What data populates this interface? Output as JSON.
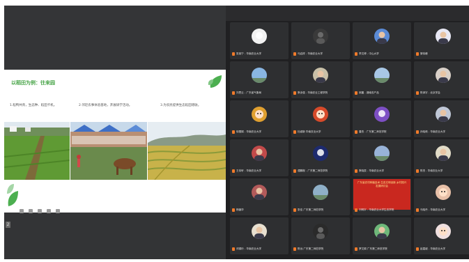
{
  "slide": {
    "title": "以稻田为例：往来园",
    "captions": [
      "1.稻鸭共育，生态种、稻田卡机。",
      "2.邻近农事体验基地，开展研学活动。",
      "3.为农民提供生态稻田增收。"
    ],
    "photos": [
      {
        "name": "rice-field-ridge-photo"
      },
      {
        "name": "farm-crowd-cattle-photo"
      },
      {
        "name": "rice-terrace-photo"
      }
    ],
    "page_indicator": "2"
  },
  "participants": [
    {
      "name": "张某宁 - 华南农业大学",
      "mic": "#f07a2a",
      "avatar": "#f2f2f2",
      "tone": "icon"
    },
    {
      "name": "马启祥 - 华南农业大学",
      "mic": "#f07a2a",
      "avatar": "#3a3a3a",
      "tone": "dark",
      "host": true
    },
    {
      "name": "李文博 - 中山大学",
      "mic": "#f07a2a",
      "avatar": "#5b8bd6",
      "tone": "person"
    },
    {
      "name": "黎伟峰",
      "mic": "#f07a2a",
      "avatar": "#e8e8f4",
      "tone": "person"
    },
    {
      "name": "刘思云 - 广东省气象局",
      "mic": "#f07a2a",
      "avatar": "#89b6e2",
      "tone": "sky"
    },
    {
      "name": "蔡泳强 - 华南农业工程学院",
      "mic": "#f07a2a",
      "avatar": "#c9c0a8",
      "tone": "person"
    },
    {
      "name": "邱晨 - 湖南农产品",
      "mic": "#f07a2a",
      "avatar": "#a8c7e6",
      "tone": "sky"
    },
    {
      "name": "陈泽宇 - 北京学会",
      "mic": "#f07a2a",
      "avatar": "#d9d0c8",
      "tone": "person"
    },
    {
      "name": "徐雪娟 - 华南农业大学",
      "mic": "#f07a2a",
      "avatar": "#e0a030",
      "tone": "cartoon"
    },
    {
      "name": "杜颖新 华南农业大学",
      "mic": "#f07a2a",
      "avatar": "#d64a2a",
      "tone": "cartoon"
    },
    {
      "name": "唐杰 - 广东第二师范学院",
      "mic": "#f07a2a",
      "avatar": "#7d4fc4",
      "tone": "icon"
    },
    {
      "name": "孙晓莉 - 华南农业大学",
      "mic": "#f07a2a",
      "avatar": "#bfc7d6",
      "tone": "person"
    },
    {
      "name": "王伟轩 - 华南农业大学",
      "mic": "#f07a2a",
      "avatar": "#c24a4a",
      "tone": "person"
    },
    {
      "name": "谭鹏程 - 广东第二师范学院",
      "mic": "#f07a2a",
      "avatar": "#1d2a6e",
      "tone": "icon"
    },
    {
      "name": "蔡晓辰 - 华南农业大学",
      "mic": "#f07a2a",
      "avatar": "#98b3d8",
      "tone": "sky"
    },
    {
      "name": "陈杰 - 华南农业大学",
      "mic": "#f07a2a",
      "avatar": "#e2dcc8",
      "tone": "person"
    },
    {
      "name": "杨薇华",
      "mic": "#f07a2a",
      "avatar": "#b35a5a",
      "tone": "person"
    },
    {
      "name": "张佳 广东第二师范学院",
      "mic": "#f07a2a",
      "avatar": "#8fb0c8",
      "tone": "sky"
    },
    {
      "name": "刘明宇 - 华南农业大学生态学院",
      "mic": "#f07a2a",
      "avatar": "#c9281f",
      "tone": "share",
      "share_title": "广东省农村种植技术 生态文明创新 乡村振兴发展研讨会"
    },
    {
      "name": "马晓丹 - 华南农业大学",
      "mic": "#f07a2a",
      "avatar": "#e8c0a8",
      "tone": "cartoon"
    },
    {
      "name": "邓锦玲 - 华南农业大学",
      "mic": "#f07a2a",
      "avatar": "#e8e0d0",
      "tone": "person"
    },
    {
      "name": "陈远 广东第二师范学院",
      "mic": "#f07a2a",
      "avatar": "#2a2a2a",
      "tone": "dark"
    },
    {
      "name": "罗文娟 广东第二师范学院",
      "mic": "#f07a2a",
      "avatar": "#6fb87a",
      "tone": "person"
    },
    {
      "name": "赵嘉颖 - 华南农业大学",
      "mic": "#f07a2a",
      "avatar": "#f0e0e0",
      "tone": "cartoon"
    }
  ],
  "colors": {
    "accent_green": "#47a447",
    "mic_orange": "#f07a2a",
    "grid_bg": "#202022",
    "tile_bg": "#2e2f31"
  }
}
